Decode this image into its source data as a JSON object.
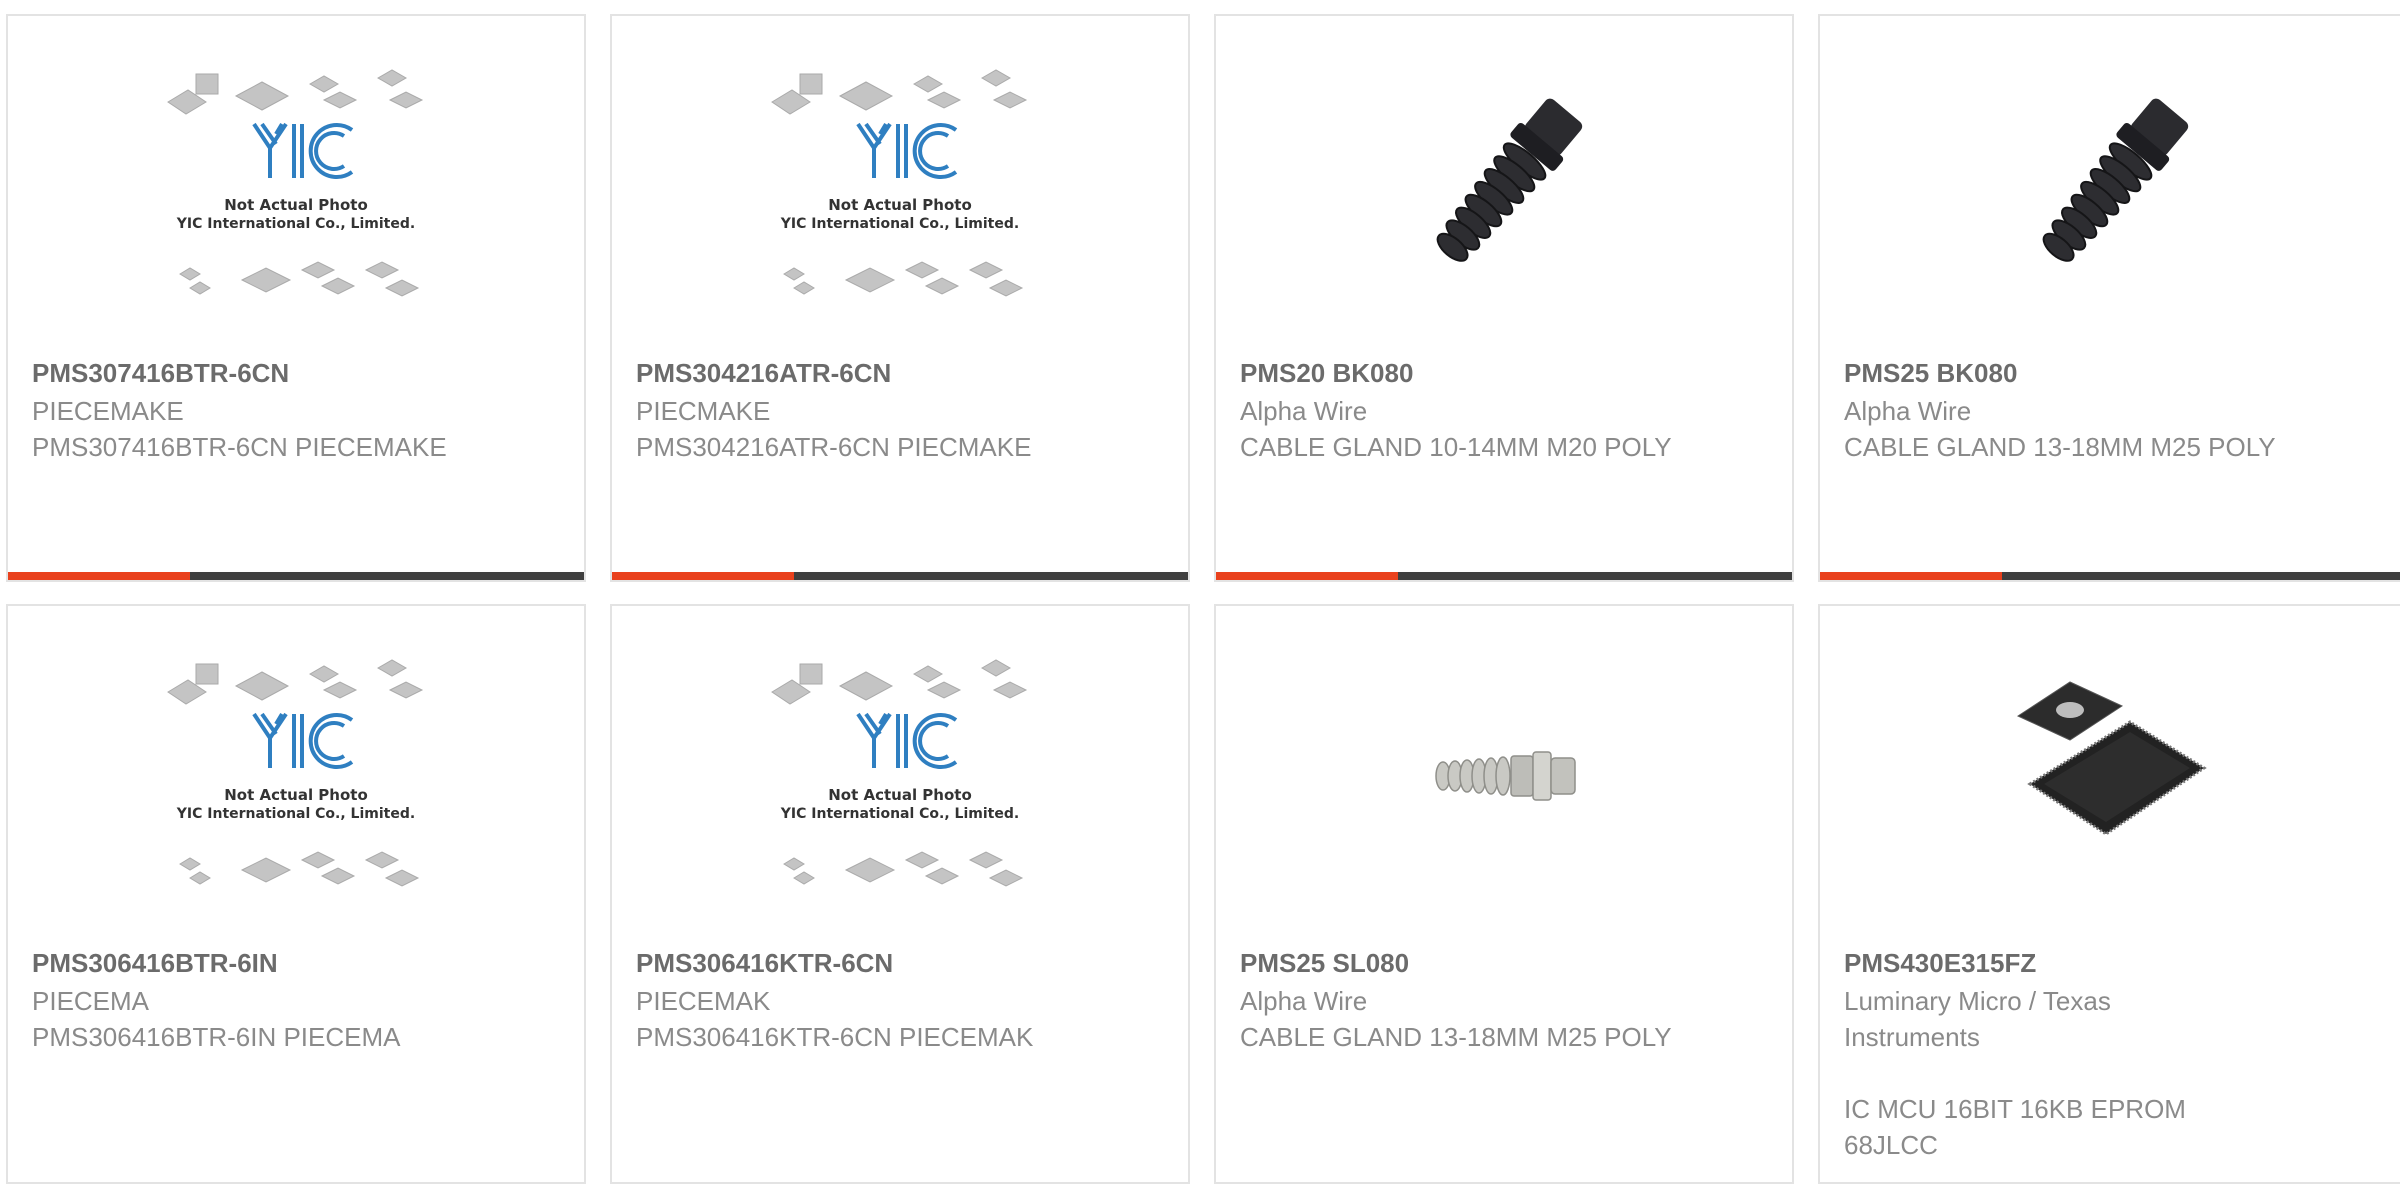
{
  "products": [
    {
      "part_number": "PMS307416BTR-6CN",
      "manufacturer": "PIECEMAKE",
      "description": "PMS307416BTR-6CN PIECEMAKE",
      "image": "yic-placeholder",
      "placeholder_caption_1": "Not Actual Photo",
      "placeholder_caption_2": "YIC International Co., Limited."
    },
    {
      "part_number": "PMS304216ATR-6CN",
      "manufacturer": "PIECMAKE",
      "description": "PMS304216ATR-6CN PIECMAKE",
      "image": "yic-placeholder",
      "placeholder_caption_1": "Not Actual Photo",
      "placeholder_caption_2": "YIC International Co., Limited."
    },
    {
      "part_number": "PMS20 BK080",
      "manufacturer": "Alpha Wire",
      "description": "CABLE GLAND 10-14MM M20 POLY",
      "image": "cable-gland-black"
    },
    {
      "part_number": "PMS25 BK080",
      "manufacturer": "Alpha Wire",
      "description": "CABLE GLAND 13-18MM M25 POLY",
      "image": "cable-gland-black"
    },
    {
      "part_number": "PMS306416BTR-6IN",
      "manufacturer": "PIECEMA",
      "description": "PMS306416BTR-6IN PIECEMA",
      "image": "yic-placeholder",
      "placeholder_caption_1": "Not Actual Photo",
      "placeholder_caption_2": "YIC International Co., Limited."
    },
    {
      "part_number": "PMS306416KTR-6CN",
      "manufacturer": "PIECEMAK",
      "description": "PMS306416KTR-6CN PIECEMAK",
      "image": "yic-placeholder",
      "placeholder_caption_1": "Not Actual Photo",
      "placeholder_caption_2": "YIC International Co., Limited."
    },
    {
      "part_number": "PMS25 SL080",
      "manufacturer": "Alpha Wire",
      "description": "CABLE GLAND 13-18MM M25 POLY",
      "image": "cable-gland-gray"
    },
    {
      "part_number": "PMS430E315FZ",
      "manufacturer": "Luminary Micro / Texas Instruments",
      "description": "IC MCU 16BIT 16KB EPROM 68JLCC",
      "image": "plcc-chip"
    }
  ],
  "colors": {
    "accent": "#e9411d",
    "bar": "#3f3f3f",
    "border": "#e3e3e3",
    "title_text": "#6b6b6b",
    "body_text": "#8a8a8a",
    "logo_blue": "#2f7fc1"
  }
}
